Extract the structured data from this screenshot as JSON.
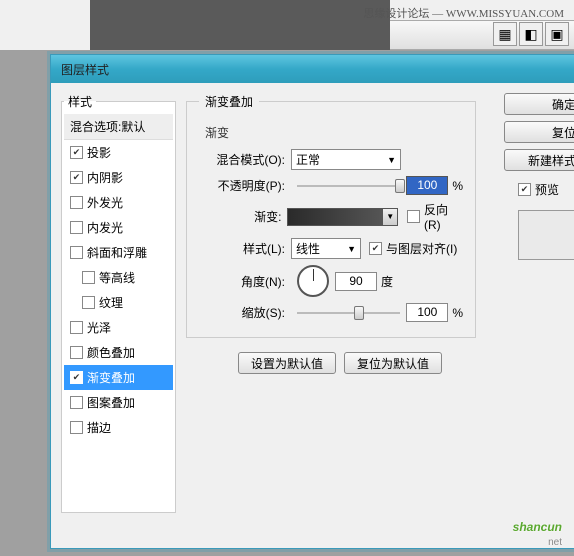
{
  "watermark_header": "思缘设计论坛 — WWW.MISSYUAN.COM",
  "dialog": {
    "title": "图层样式"
  },
  "left": {
    "legend": "样式",
    "blending_options": "混合选项:默认",
    "items": [
      {
        "label": "投影",
        "checked": true,
        "indent": false
      },
      {
        "label": "内阴影",
        "checked": true,
        "indent": false
      },
      {
        "label": "外发光",
        "checked": false,
        "indent": false
      },
      {
        "label": "内发光",
        "checked": false,
        "indent": false
      },
      {
        "label": "斜面和浮雕",
        "checked": false,
        "indent": false
      },
      {
        "label": "等高线",
        "checked": false,
        "indent": true
      },
      {
        "label": "纹理",
        "checked": false,
        "indent": true
      },
      {
        "label": "光泽",
        "checked": false,
        "indent": false
      },
      {
        "label": "颜色叠加",
        "checked": false,
        "indent": false
      },
      {
        "label": "渐变叠加",
        "checked": true,
        "indent": false,
        "selected": true
      },
      {
        "label": "图案叠加",
        "checked": false,
        "indent": false
      },
      {
        "label": "描边",
        "checked": false,
        "indent": false
      }
    ]
  },
  "main": {
    "legend": "渐变叠加",
    "sub": "渐变",
    "blend_mode_label": "混合模式(O):",
    "blend_mode_value": "正常",
    "opacity_label": "不透明度(P):",
    "opacity_value": "100",
    "opacity_unit": "%",
    "gradient_label": "渐变:",
    "reverse_label": "反向(R)",
    "style_label": "样式(L):",
    "style_value": "线性",
    "align_label": "与图层对齐(I)",
    "angle_label": "角度(N):",
    "angle_value": "90",
    "angle_unit": "度",
    "scale_label": "缩放(S):",
    "scale_value": "100",
    "scale_unit": "%",
    "btn_default": "设置为默认值",
    "btn_reset": "复位为默认值"
  },
  "right": {
    "ok": "确定",
    "cancel": "复位",
    "newstyle": "新建样式",
    "preview_label": "预览"
  },
  "watermark": {
    "main": "shancun",
    "sub": "net"
  }
}
